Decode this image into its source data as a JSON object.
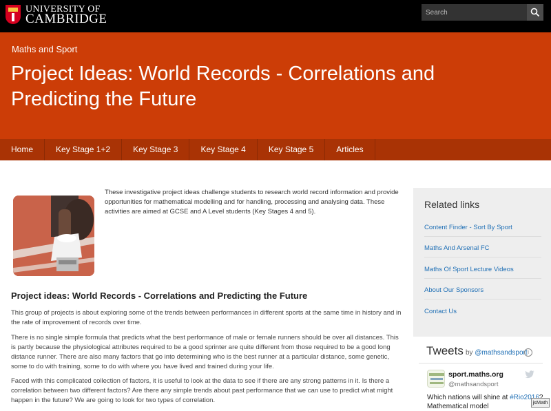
{
  "header": {
    "logo_line1": "UNIVERSITY OF",
    "logo_line2": "CAMBRIDGE",
    "search_placeholder": "Search"
  },
  "hero": {
    "section": "Maths and Sport",
    "title": "Project Ideas: World Records - Correlations and Predicting the Future"
  },
  "nav": {
    "items": [
      "Home",
      "Key Stage 1+2",
      "Key Stage 3",
      "Key Stage 4",
      "Key Stage 5",
      "Articles"
    ]
  },
  "main": {
    "intro": "These investigative project ideas challenge students to research world record information and provide opportunities for mathematical modelling and for handling, processing and analysing data. These activities are aimed at GCSE and A Level students (Key Stages 4 and 5).",
    "article_title": "Project ideas: World Records - Correlations and Predicting the Future",
    "paragraphs": [
      "This group of projects is about exploring some of the trends between performances in different sports at the same time in history and in the rate of improvement of records over time.",
      "There is no single simple formula that predicts what the best performance of male or female runners should be over all distances. This is partly because the physiological attributes required to be a good sprinter are quite different from those required to be a good long distance runner. There are also many factors that go into determining who is the best runner at a particular distance, some genetic, some to do with training, some to do with where you have lived and trained during your life.",
      "Faced with this complicated collection of factors, it is useful to look at the data to see if there are any strong patterns in it. Is there a correlation between two different factors? Are there any simple trends about past performance that we can use to predict what might happen in the future? We are going to look for two types of correlation."
    ]
  },
  "sidebar": {
    "related_title": "Related links",
    "links": [
      "Content Finder - Sort By Sport",
      "Maths And Arsenal FC",
      "Maths Of Sport Lecture Videos",
      "About Our Sponsors",
      "Contact Us"
    ],
    "tweets_title": "Tweets",
    "tweets_by": "by",
    "tweets_handle": "@mathsandsport",
    "tweet": {
      "name": "sport.maths.org",
      "handle": "@mathsandsport",
      "text_start": "Which nations will shine at",
      "hashtag": "#Rio2016",
      "text_end": "? Mathematical model"
    }
  },
  "jsmath_label": "jsMath",
  "colors": {
    "hero": "#cc3d07",
    "nav": "#a93305",
    "link": "#1f6fb5"
  }
}
